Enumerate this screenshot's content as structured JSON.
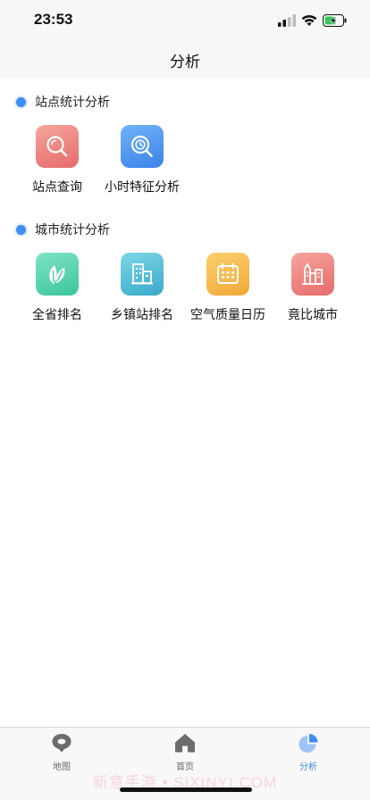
{
  "status_bar": {
    "time": "23:53"
  },
  "nav": {
    "title": "分析"
  },
  "sections": [
    {
      "title": "站点统计分析",
      "items": [
        {
          "label": "站点查询",
          "icon": "magnifier-icon",
          "color_from": "#f6a59b",
          "color_to": "#e56b6b"
        },
        {
          "label": "小时特征分析",
          "icon": "clock-search-icon",
          "color_from": "#6fb3f7",
          "color_to": "#3b82e8"
        }
      ]
    },
    {
      "title": "城市统计分析",
      "items": [
        {
          "label": "全省排名",
          "icon": "leaf-icon",
          "color_from": "#7ee3c6",
          "color_to": "#3cc59c"
        },
        {
          "label": "乡镇站排名",
          "icon": "building-icon",
          "color_from": "#7cd7e6",
          "color_to": "#3aa9c9"
        },
        {
          "label": "空气质量日历",
          "icon": "calendar-icon",
          "color_from": "#fbcf6b",
          "color_to": "#f1a93a"
        },
        {
          "label": "竟比城市",
          "icon": "city-icon",
          "color_from": "#f6a59b",
          "color_to": "#e56b6b"
        }
      ]
    }
  ],
  "tabs": [
    {
      "label": "地图",
      "icon": "map-pin-icon",
      "active": false
    },
    {
      "label": "首页",
      "icon": "home-icon",
      "active": false
    },
    {
      "label": "分析",
      "icon": "pie-chart-icon",
      "active": true
    }
  ],
  "watermark": "新意手游 • SIXINYI.COM",
  "colors": {
    "accent": "#3d8ef0",
    "nav_bg": "#f7f7f7"
  }
}
